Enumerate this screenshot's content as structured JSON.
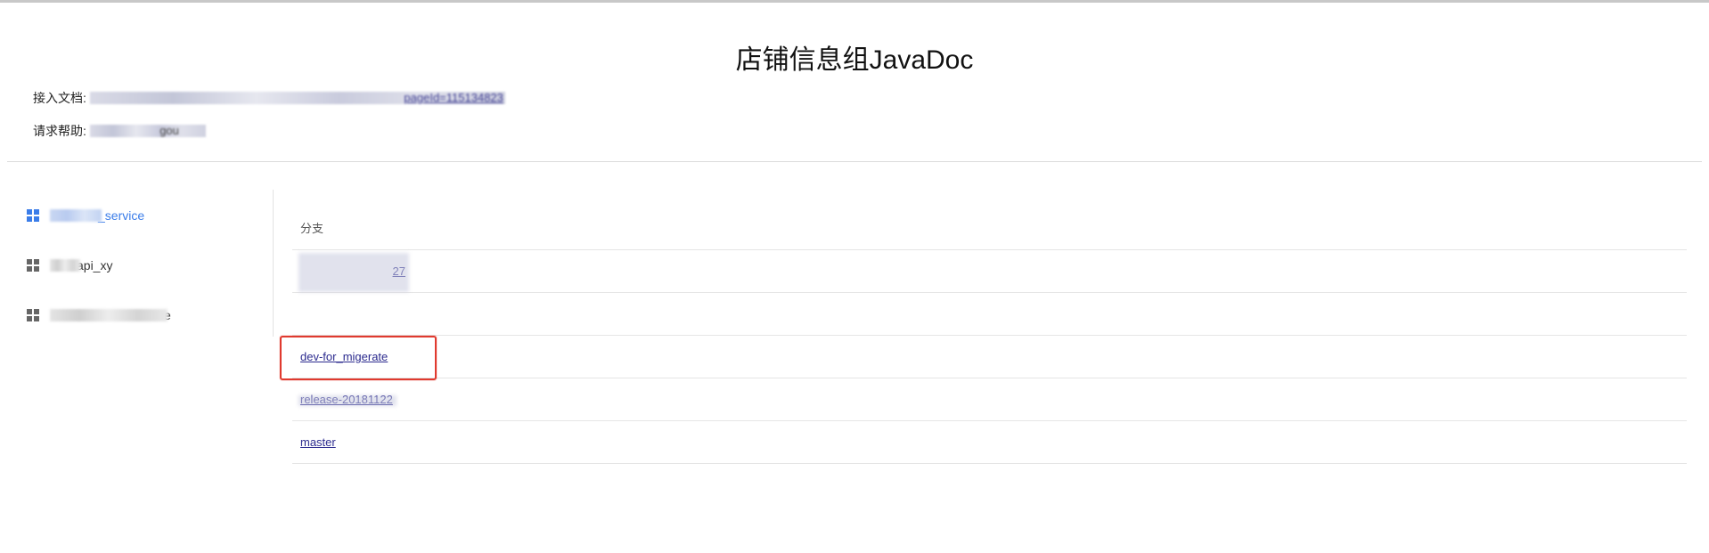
{
  "page": {
    "title": "店铺信息组JavaDoc"
  },
  "info": {
    "doc_label": "接入文档:",
    "doc_link_suffix": "pageId=115134823",
    "help_label": "请求帮助:",
    "help_value_suffix": "gou"
  },
  "sidebar": {
    "items": [
      {
        "label": "_service",
        "icon": "grid-icon",
        "active": true,
        "color": "#3b7de9"
      },
      {
        "label": "api_xy",
        "icon": "grid-icon",
        "active": false,
        "color": "#555555"
      },
      {
        "label": "e",
        "icon": "grid-icon",
        "active": false,
        "color": "#555555"
      }
    ]
  },
  "branches": {
    "header": "分支",
    "rows": [
      {
        "label": "27",
        "blurred": true
      },
      {
        "label": "",
        "blurred": true
      },
      {
        "label": "dev-for_migerate",
        "blurred": false,
        "highlighted": true
      },
      {
        "label": "release-20181122",
        "blurred": true
      },
      {
        "label": "master",
        "blurred": false
      }
    ]
  },
  "colors": {
    "link": "#2b2a8e",
    "active": "#3b7de9",
    "highlight": "#e03a2f"
  }
}
